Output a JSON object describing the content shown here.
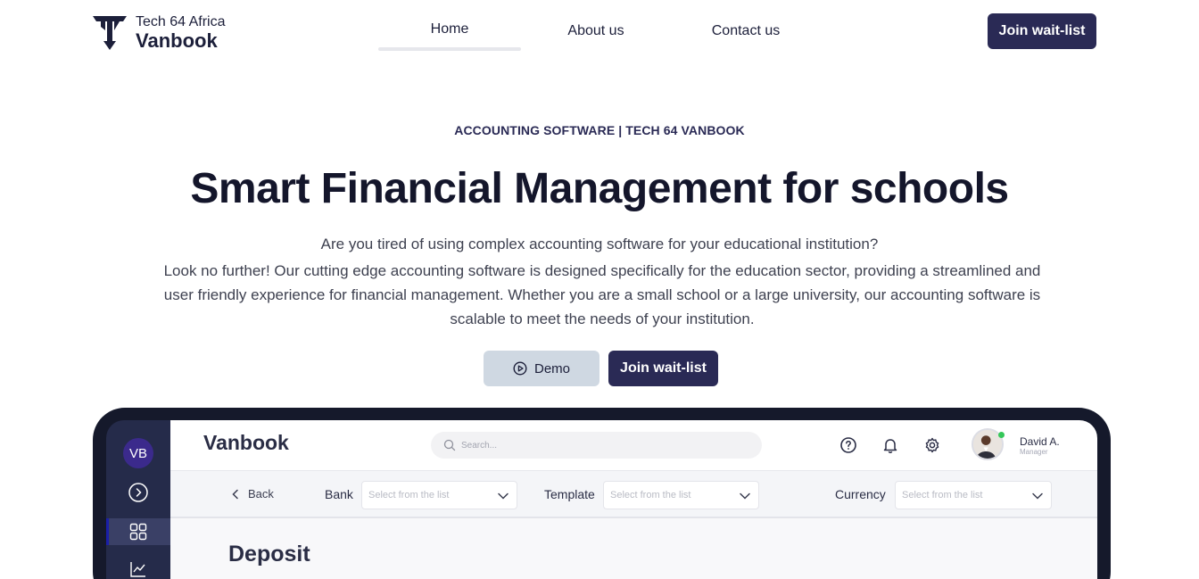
{
  "header": {
    "logo_top": "Tech 64 Africa",
    "logo_bottom": "Vanbook",
    "nav": [
      {
        "label": "Home",
        "active": true
      },
      {
        "label": "About us",
        "active": false
      },
      {
        "label": "Contact us",
        "active": false
      }
    ],
    "cta_label": "Join wait-list"
  },
  "hero": {
    "eyebrow": "ACCOUNTING SOFTWARE | TECH 64 VANBOOK",
    "title": "Smart Financial Management for schools",
    "lead": "Are you tired of using complex accounting software for your educational institution?",
    "body": "Look no further! Our cutting edge accounting software is designed specifically for the education sector, providing a streamlined and user friendly experience for financial management. Whether you are a small school or a large university, our accounting software is scalable to meet the needs of your institution.",
    "demo_label": "Demo",
    "join_label": "Join wait-list"
  },
  "app_preview": {
    "sidebar_avatar": "VB",
    "brand": "Vanbook",
    "search_placeholder": "Search...",
    "user_name": "David A.",
    "user_role": "Manager",
    "back_label": "Back",
    "bank_label": "Bank",
    "bank_placeholder": "Select from the list",
    "template_label": "Template",
    "template_placeholder": "Select from the list",
    "currency_label": "Currency",
    "currency_placeholder": "Select from the list",
    "page_heading": "Deposit"
  },
  "colors": {
    "primary": "#2a2a55",
    "demo_button_bg": "#cfd8e2",
    "device_frame": "#15192b",
    "sidebar": "#252b4a",
    "online_status": "#35c759"
  },
  "icons": [
    "logo-icon",
    "play-icon",
    "search-icon",
    "chevron-right-icon",
    "grid-icon",
    "chart-icon",
    "help-icon",
    "bell-icon",
    "gear-icon",
    "chevron-left-icon",
    "chevron-down-icon"
  ]
}
